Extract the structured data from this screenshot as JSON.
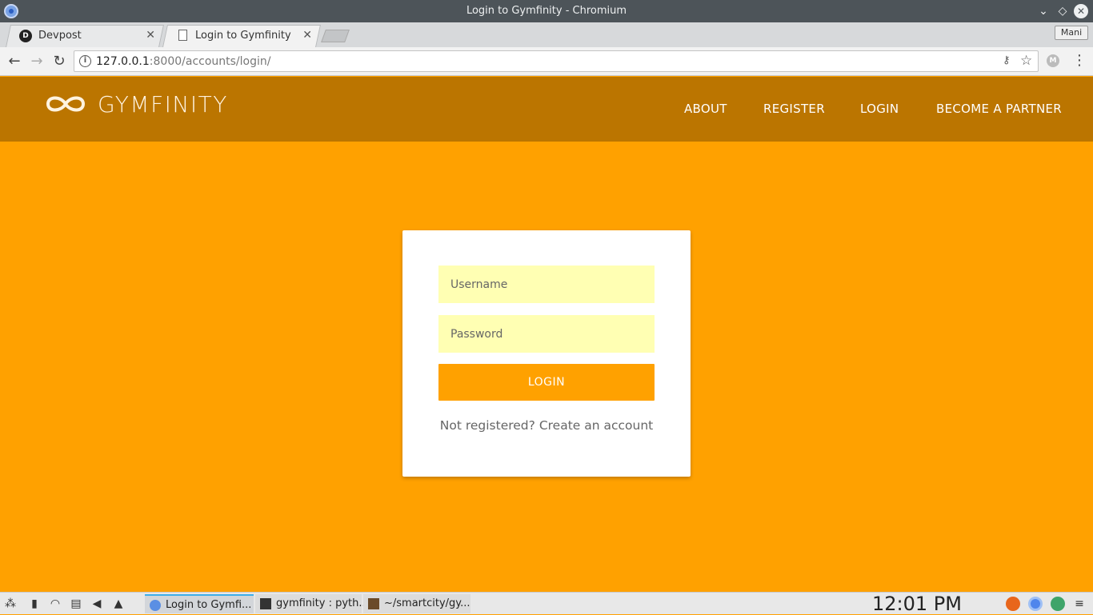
{
  "window": {
    "title": "Login to Gymfinity - Chromium",
    "controls": {
      "minimize": "⌄",
      "maximize": "◇",
      "close": "✕"
    }
  },
  "tabs": [
    {
      "label": "Devpost",
      "favicon": "D",
      "close": "✕"
    },
    {
      "label": "Login to Gymfinity",
      "close": "✕"
    }
  ],
  "profile": {
    "label": "Mani"
  },
  "toolbar": {
    "url_host": "127.0.0.1",
    "url_rest": ":8000/accounts/login/",
    "info_icon": "i",
    "extension_label": "M"
  },
  "site": {
    "brand": "GYMFINITY",
    "nav": {
      "about": "ABOUT",
      "register": "REGISTER",
      "login": "LOGIN",
      "partner": "BECOME A PARTNER"
    }
  },
  "form": {
    "username_placeholder": "Username",
    "password_placeholder": "Password",
    "submit_label": "LOGIN",
    "register_prompt": "Not registered?",
    "register_link": "Create an account"
  },
  "taskbar": {
    "tasks": [
      {
        "label": "Login to Gymfi..."
      },
      {
        "label": "gymfinity : pyth..."
      },
      {
        "label": "~/smartcity/gy..."
      }
    ],
    "clock": "12:01 PM"
  },
  "colors": {
    "page_bg": "#ffa100",
    "header_bg": "#bb7500",
    "input_bg": "#ffffb3",
    "button_bg": "#ffa100"
  }
}
